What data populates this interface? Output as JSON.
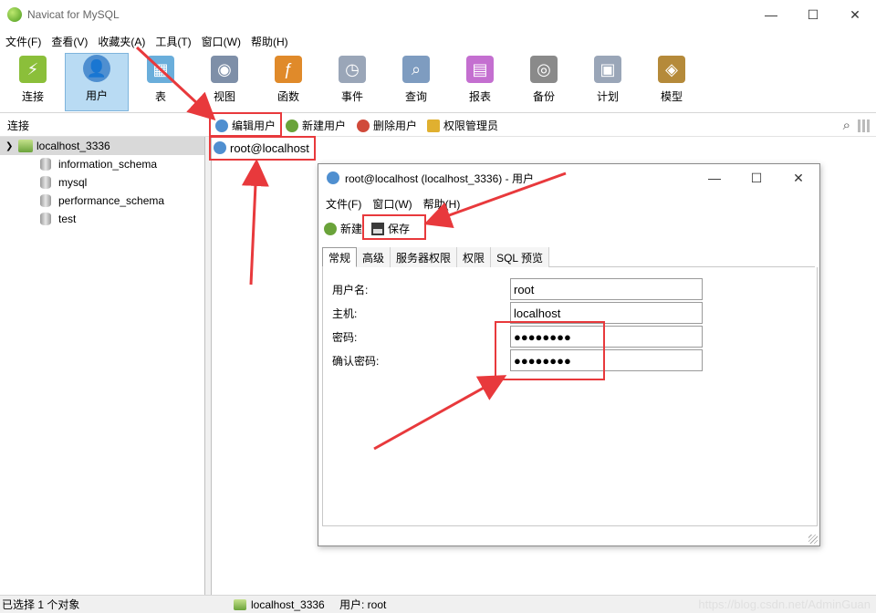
{
  "window": {
    "title": "Navicat for MySQL",
    "buttons": [
      "—",
      "☐",
      "✕"
    ]
  },
  "menu": [
    "文件(F)",
    "查看(V)",
    "收藏夹(A)",
    "工具(T)",
    "窗口(W)",
    "帮助(H)"
  ],
  "toolbar": [
    {
      "label": "连接",
      "icon": "connection-icon",
      "color": "#8bbf3a"
    },
    {
      "label": "用户",
      "icon": "user-icon",
      "color": "#4f8fd0",
      "active": true
    },
    {
      "label": "表",
      "icon": "table-icon",
      "color": "#6aaedb"
    },
    {
      "label": "视图",
      "icon": "view-icon",
      "color": "#7e8fa8"
    },
    {
      "label": "函数",
      "icon": "function-icon",
      "color": "#e08a2a"
    },
    {
      "label": "事件",
      "icon": "event-icon",
      "color": "#9aa6b8"
    },
    {
      "label": "查询",
      "icon": "query-icon",
      "color": "#7e9cc0"
    },
    {
      "label": "报表",
      "icon": "report-icon",
      "color": "#c46fd0"
    },
    {
      "label": "备份",
      "icon": "backup-icon",
      "color": "#8a8a8a"
    },
    {
      "label": "计划",
      "icon": "schedule-icon",
      "color": "#9aa6b8"
    },
    {
      "label": "模型",
      "icon": "model-icon",
      "color": "#b58a3a"
    }
  ],
  "subbar": {
    "connection_label": "连接",
    "edit_user": "编辑用户",
    "new_user": "新建用户",
    "delete_user": "删除用户",
    "privilege_manager": "权限管理员"
  },
  "tree": {
    "root": "localhost_3336",
    "databases": [
      "information_schema",
      "mysql",
      "performance_schema",
      "test"
    ]
  },
  "user_object": "root@localhost",
  "dialog": {
    "title": "root@localhost (localhost_3336) - 用户",
    "menu": [
      "文件(F)",
      "窗口(W)",
      "帮助(H)"
    ],
    "toolbar": {
      "new": "新建",
      "save": "保存"
    },
    "tabs": [
      "常规",
      "高级",
      "服务器权限",
      "权限",
      "SQL 预览"
    ],
    "fields": {
      "username_label": "用户名:",
      "username_value": "root",
      "host_label": "主机:",
      "host_value": "localhost",
      "password_label": "密码:",
      "password_value": "●●●●●●●●",
      "confirm_label": "确认密码:",
      "confirm_value": "●●●●●●●●"
    }
  },
  "status": {
    "left": "已选择 1 个对象",
    "connection": "localhost_3336",
    "user": "用户: root",
    "watermark": "https://blog.csdn.net/AdminGuan"
  },
  "colors": {
    "highlight": "#e8393c",
    "active_tool": "#b9dbf3"
  }
}
